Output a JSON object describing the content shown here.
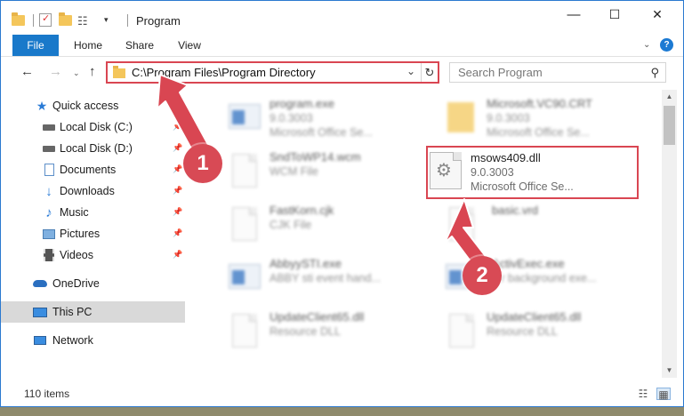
{
  "window": {
    "title": "Program",
    "controls": {
      "minimize": "—",
      "maximize": "☐",
      "close": "✕"
    }
  },
  "ribbon": {
    "tabs": [
      "File",
      "Home",
      "Share",
      "View"
    ]
  },
  "address_bar": {
    "path": "C:\\Program Files\\Program Directory"
  },
  "search": {
    "placeholder": "Search Program"
  },
  "sidebar": {
    "items": [
      {
        "label": "Quick access",
        "icon": "star-icon"
      },
      {
        "label": "Local Disk (C:)",
        "icon": "drive-icon"
      },
      {
        "label": "Local Disk (D:)",
        "icon": "drive-icon"
      },
      {
        "label": "Documents",
        "icon": "documents-icon"
      },
      {
        "label": "Downloads",
        "icon": "download-icon"
      },
      {
        "label": "Music",
        "icon": "music-icon"
      },
      {
        "label": "Pictures",
        "icon": "pictures-icon"
      },
      {
        "label": "Videos",
        "icon": "videos-icon"
      },
      {
        "label": "OneDrive",
        "icon": "cloud-icon"
      },
      {
        "label": "This PC",
        "icon": "pc-icon"
      },
      {
        "label": "Network",
        "icon": "network-icon"
      }
    ]
  },
  "files": [
    {
      "name": "program.exe",
      "line2": "9.0.3003",
      "line3": "Microsoft Office Se..."
    },
    {
      "name": "Microsoft.VC90.CRT",
      "line2": "9.0.3003",
      "line3": "Microsoft Office Se..."
    },
    {
      "name": "SndToWP14.wcm",
      "line2": "WCM File",
      "line3": ""
    },
    {
      "name": "msows409.dll",
      "line2": "9.0.3003",
      "line3": "Microsoft Office Se..."
    },
    {
      "name": "FastKorn.cjk",
      "line2": "CJK File",
      "line3": ""
    },
    {
      "name": "basic.vrd",
      "line2": "",
      "line3": ""
    },
    {
      "name": "AbbyySTI.exe",
      "line2": "ABBY sti event hand...",
      "line3": ""
    },
    {
      "name": "ActivExec.exe",
      "line2": "...r background exe...",
      "line3": ""
    },
    {
      "name": "UpdateClient65.dll",
      "line2": "Resource DLL",
      "line3": ""
    },
    {
      "name": "UpdateClient65.dll",
      "line2": "Resource DLL",
      "line3": ""
    }
  ],
  "status": {
    "item_count": "110 items"
  },
  "annotations": {
    "step1": "1",
    "step2": "2",
    "color": "#d94652"
  }
}
